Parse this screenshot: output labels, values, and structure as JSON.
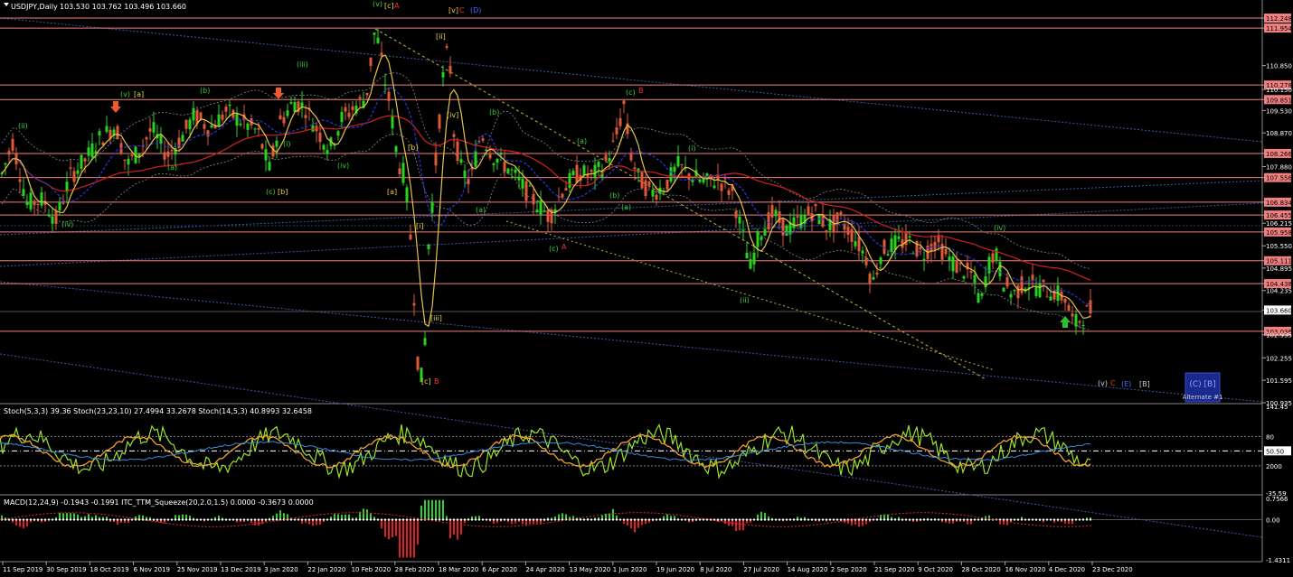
{
  "chart_header": {
    "symbol": "USDJPY,Daily",
    "ohlc": "103.530 103.762 103.496 103.660",
    "stoch_header": "Stoch(5,3,3) 39.36  Stoch(23,23,10) 27.4994 33.2678  Stoch(14,5,3) 40.8993 32.6458",
    "macd_header": "MACD(12,24,9) -0.1943 -0.1991  ITC_TTM_Squeeze(20,2.0,1.5) 0.0000 -0.3673 0.0000"
  },
  "colors": {
    "background": "#000000",
    "bull": "#26d41f",
    "bear": "#e05a3a",
    "resistance": "#f08080",
    "ma_red": "#d42020",
    "ma_blue": "#2a36e0",
    "ma_yellow": "#e7c24a",
    "stoch_fast": "#9be22a",
    "stoch_slow": "#f0a030"
  },
  "chart_data": {
    "type": "line",
    "title": "USDJPY,Daily",
    "y_axis_ticks": [
      "112.248",
      "111.954",
      "110.850",
      "110.278",
      "110.150",
      "109.851",
      "109.530",
      "108.870",
      "108.266",
      "107.880",
      "107.556",
      "106.834",
      "106.455",
      "106.215",
      "105.958",
      "105.550",
      "105.111",
      "104.895",
      "104.438",
      "104.235",
      "103.660",
      "103.036",
      "102.935",
      "102.255",
      "101.595",
      "100.935"
    ],
    "highlighted_levels": [
      {
        "label": "112.248",
        "value": 112.248
      },
      {
        "label": "111.954",
        "value": 111.954
      },
      {
        "label": "110.278",
        "value": 110.278
      },
      {
        "label": "109.851",
        "value": 109.851
      },
      {
        "label": "108.266",
        "value": 108.266
      },
      {
        "label": "107.556",
        "value": 107.556
      },
      {
        "label": "106.834",
        "value": 106.834
      },
      {
        "label": "106.455",
        "value": 106.455
      },
      {
        "label": "105.958",
        "value": 105.958
      },
      {
        "label": "105.111",
        "value": 105.111
      },
      {
        "label": "104.438",
        "value": 104.438
      },
      {
        "label": "103.036",
        "value": 103.036
      }
    ],
    "current_price": {
      "label": "103.660",
      "value": 103.66
    },
    "ylim": [
      100.935,
      112.248
    ],
    "x_axis_labels": [
      "11 Sep 2019",
      "30 Sep 2019",
      "18 Oct 2019",
      "6 Nov 2019",
      "25 Nov 2019",
      "13 Dec 2019",
      "3 Jan 2020",
      "22 Jan 2020",
      "10 Feb 2020",
      "28 Feb 2020",
      "18 Mar 2020",
      "6 Apr 2020",
      "24 Apr 2020",
      "13 May 2020",
      "1 Jun 2020",
      "19 Jun 2020",
      "8 Jul 2020",
      "27 Jul 2020",
      "14 Aug 2020",
      "2 Sep 2020",
      "21 Sep 2020",
      "9 Oct 2020",
      "28 Oct 2020",
      "16 Nov 2020",
      "4 Dec 2020",
      "23 Dec 2020"
    ],
    "price_path": [
      [
        0,
        107.5
      ],
      [
        14,
        108.6
      ],
      [
        30,
        106.8
      ],
      [
        48,
        106.9
      ],
      [
        62,
        106.3
      ],
      [
        78,
        107.6
      ],
      [
        95,
        108.1
      ],
      [
        110,
        108.7
      ],
      [
        128,
        109.1
      ],
      [
        140,
        107.9
      ],
      [
        155,
        108.4
      ],
      [
        168,
        109.0
      ],
      [
        185,
        108.2
      ],
      [
        200,
        108.7
      ],
      [
        215,
        109.4
      ],
      [
        232,
        109.0
      ],
      [
        250,
        109.5
      ],
      [
        268,
        109.2
      ],
      [
        285,
        108.9
      ],
      [
        298,
        107.8
      ],
      [
        310,
        109.2
      ],
      [
        325,
        109.8
      ],
      [
        338,
        109.6
      ],
      [
        352,
        108.9
      ],
      [
        365,
        108.4
      ],
      [
        378,
        109.3
      ],
      [
        395,
        109.7
      ],
      [
        405,
        109.9
      ],
      [
        415,
        112.0
      ],
      [
        425,
        110.5
      ],
      [
        432,
        109.6
      ],
      [
        440,
        108.0
      ],
      [
        448,
        107.6
      ],
      [
        455,
        105.5
      ],
      [
        462,
        102.2
      ],
      [
        468,
        101.4
      ],
      [
        474,
        105.6
      ],
      [
        480,
        107.4
      ],
      [
        487,
        109.6
      ],
      [
        492,
        111.1
      ],
      [
        497,
        111.2
      ],
      [
        502,
        108.9
      ],
      [
        510,
        107.8
      ],
      [
        520,
        107.4
      ],
      [
        532,
        108.9
      ],
      [
        545,
        108.2
      ],
      [
        560,
        107.9
      ],
      [
        575,
        107.4
      ],
      [
        590,
        106.9
      ],
      [
        608,
        106.4
      ],
      [
        622,
        107.2
      ],
      [
        640,
        107.7
      ],
      [
        655,
        107.6
      ],
      [
        668,
        107.9
      ],
      [
        680,
        108.6
      ],
      [
        690,
        109.7
      ],
      [
        697,
        108.3
      ],
      [
        705,
        107.6
      ],
      [
        720,
        107.1
      ],
      [
        735,
        107.3
      ],
      [
        750,
        107.9
      ],
      [
        765,
        107.6
      ],
      [
        780,
        107.4
      ],
      [
        795,
        107.5
      ],
      [
        810,
        107.1
      ],
      [
        820,
        106.0
      ],
      [
        830,
        104.9
      ],
      [
        840,
        105.9
      ],
      [
        855,
        106.5
      ],
      [
        870,
        106.0
      ],
      [
        885,
        106.3
      ],
      [
        900,
        106.6
      ],
      [
        915,
        106.1
      ],
      [
        930,
        106.3
      ],
      [
        945,
        105.8
      ],
      [
        958,
        105.2
      ],
      [
        965,
        104.4
      ],
      [
        975,
        105.4
      ],
      [
        990,
        105.6
      ],
      [
        1005,
        105.7
      ],
      [
        1020,
        105.3
      ],
      [
        1035,
        105.7
      ],
      [
        1048,
        105.2
      ],
      [
        1060,
        104.9
      ],
      [
        1075,
        104.7
      ],
      [
        1085,
        103.8
      ],
      [
        1092,
        104.9
      ],
      [
        1100,
        105.4
      ],
      [
        1110,
        104.5
      ],
      [
        1120,
        104.1
      ],
      [
        1135,
        104.5
      ],
      [
        1150,
        104.3
      ],
      [
        1165,
        104.2
      ],
      [
        1178,
        104.0
      ],
      [
        1188,
        103.2
      ],
      [
        1198,
        103.5
      ],
      [
        1208,
        103.7
      ]
    ]
  },
  "wave_labels_green": [
    {
      "t": "(ii)",
      "x": 20,
      "y": 142
    },
    {
      "t": "(iv)",
      "x": 68,
      "y": 251
    },
    {
      "t": "(v)",
      "x": 133,
      "y": 107
    },
    {
      "t": "(a)",
      "x": 185,
      "y": 188
    },
    {
      "t": "(b)",
      "x": 221,
      "y": 103
    },
    {
      "t": "(iii)",
      "x": 328,
      "y": 74
    },
    {
      "t": "(iv)",
      "x": 373,
      "y": 186
    },
    {
      "t": "(v)",
      "x": 412,
      "y": 7
    },
    {
      "t": "(a)",
      "x": 526,
      "y": 235
    },
    {
      "t": "(b)",
      "x": 541,
      "y": 127
    },
    {
      "t": "(a)",
      "x": 638,
      "y": 159
    },
    {
      "t": "(b)",
      "x": 674,
      "y": 219
    },
    {
      "t": "(i)",
      "x": 761,
      "y": 167
    },
    {
      "t": "(ii)",
      "x": 818,
      "y": 335
    },
    {
      "t": "(iv)",
      "x": 1099,
      "y": 255
    },
    {
      "t": "(c)",
      "x": 607,
      "y": 278
    },
    {
      "t": "(c)",
      "x": 692,
      "y": 105
    },
    {
      "t": "(i)",
      "x": 313,
      "y": 162
    },
    {
      "t": "(c)",
      "x": 294,
      "y": 215
    },
    {
      "t": "(a)",
      "x": 687,
      "y": 232
    }
  ],
  "wave_labels_yellow": [
    {
      "t": "[a]",
      "x": 148,
      "y": 107
    },
    {
      "t": "[b]",
      "x": 307,
      "y": 215
    },
    {
      "t": "[c]",
      "x": 425,
      "y": 9
    },
    {
      "t": "[a]",
      "x": 428,
      "y": 215
    },
    {
      "t": "[i]",
      "x": 460,
      "y": 253
    },
    {
      "t": "[ii]",
      "x": 482,
      "y": 43
    },
    {
      "t": "[iii]",
      "x": 476,
      "y": 355
    },
    {
      "t": "[iv]",
      "x": 494,
      "y": 130
    },
    {
      "t": "[v]",
      "x": 496,
      "y": 14
    },
    {
      "t": "[c]",
      "x": 466,
      "y": 425
    },
    {
      "t": "[b]",
      "x": 451,
      "y": 166
    }
  ],
  "wave_labels_red": [
    {
      "t": "A",
      "x": 436,
      "y": 9
    },
    {
      "t": "C",
      "x": 508,
      "y": 14
    },
    {
      "t": "B",
      "x": 480,
      "y": 425
    },
    {
      "t": "B",
      "x": 706,
      "y": 103
    },
    {
      "t": "A",
      "x": 621,
      "y": 276
    },
    {
      "t": "C",
      "x": 1228,
      "y": 427
    }
  ],
  "wave_labels_blue": [
    {
      "t": "(D)",
      "x": 520,
      "y": 14
    },
    {
      "t": "(E)",
      "x": 1240,
      "y": 428
    }
  ],
  "wave_labels_white": [
    {
      "t": "[B]",
      "x": 1260,
      "y": 428
    },
    {
      "t": "(v)",
      "x": 1214,
      "y": 427
    }
  ],
  "alternate_box": {
    "label_top": "(C) [B]",
    "label_bottom": "Alternate #1"
  },
  "stoch_axis": [
    "141.45",
    "80",
    "50.50",
    "2000",
    "-35.59"
  ],
  "macd_axis": [
    "0.7566",
    "0.00",
    "-1.4311"
  ]
}
